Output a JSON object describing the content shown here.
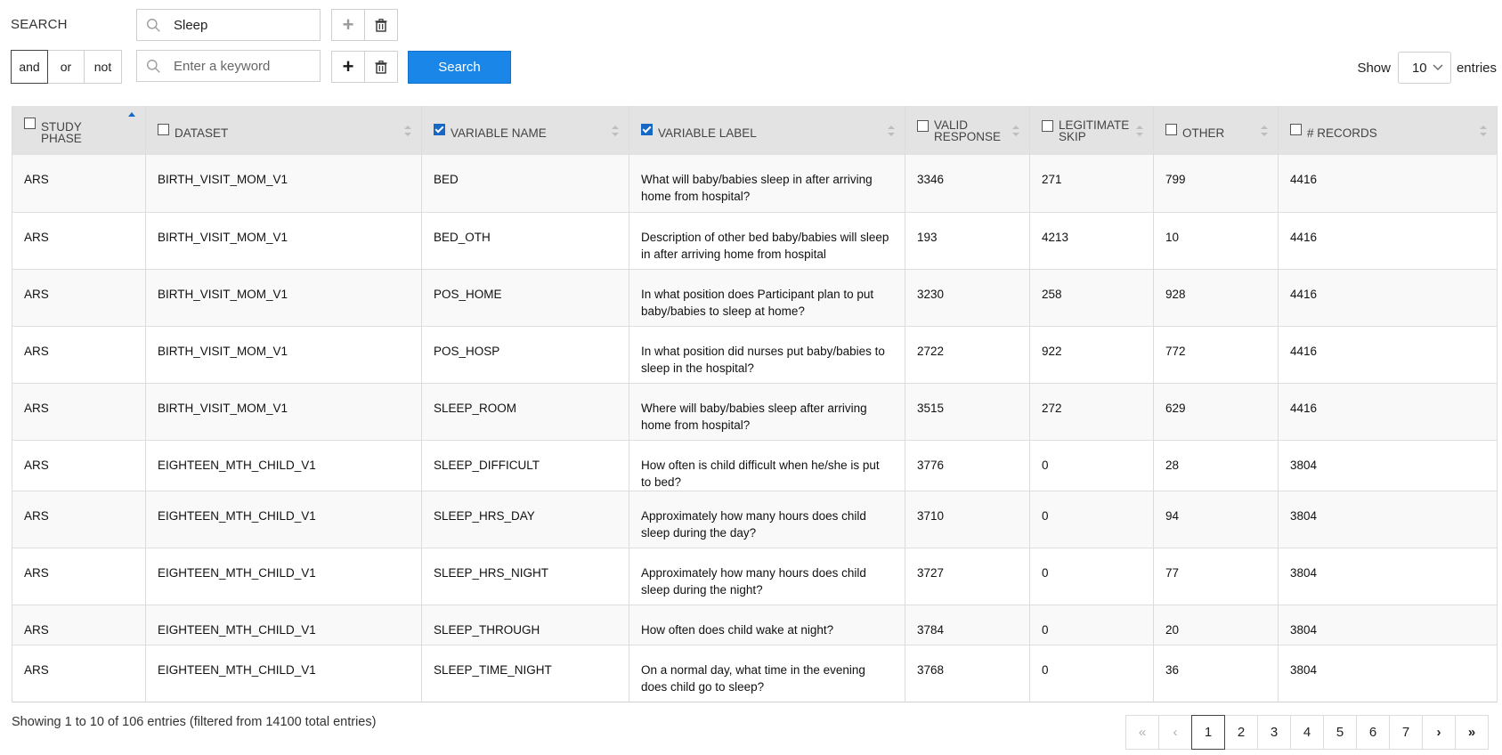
{
  "search": {
    "label": "SEARCH",
    "row1": {
      "value": "Sleep",
      "placeholder": "",
      "add_icon": "plus-icon",
      "delete_icon": "trash-icon"
    },
    "row2": {
      "value": "",
      "placeholder": "Enter a keyword",
      "add_icon": "plus-icon",
      "delete_icon": "trash-icon"
    },
    "logic_options": [
      "and",
      "or",
      "not"
    ],
    "logic_selected": "and",
    "button_label": "Search",
    "button_color": "#1a86e8"
  },
  "show": {
    "prefix": "Show",
    "value": "10",
    "suffix": "entries"
  },
  "table": {
    "columns": [
      {
        "label": "STUDY PHASE",
        "checked": false,
        "sort": "asc"
      },
      {
        "label": "DATASET",
        "checked": false,
        "sort": "none"
      },
      {
        "label": "VARIABLE NAME",
        "checked": true,
        "sort": "none"
      },
      {
        "label": "VARIABLE LABEL",
        "checked": true,
        "sort": "none"
      },
      {
        "label": "VALID RESPONSE",
        "checked": false,
        "sort": "none"
      },
      {
        "label": "LEGITIMATE SKIP",
        "checked": false,
        "sort": "none"
      },
      {
        "label": "OTHER",
        "checked": false,
        "sort": "none"
      },
      {
        "label": "# RECORDS",
        "checked": false,
        "sort": "none"
      }
    ],
    "rows": [
      [
        "ARS",
        "BIRTH_VISIT_MOM_V1",
        "BED",
        "What will baby/babies sleep in after arriving home from hospital?",
        "3346",
        "271",
        "799",
        "4416"
      ],
      [
        "ARS",
        "BIRTH_VISIT_MOM_V1",
        "BED_OTH",
        "Description of other bed baby/babies will sleep in after arriving home from hospital",
        "193",
        "4213",
        "10",
        "4416"
      ],
      [
        "ARS",
        "BIRTH_VISIT_MOM_V1",
        "POS_HOME",
        "In what position does Participant plan to put baby/babies to sleep at home?",
        "3230",
        "258",
        "928",
        "4416"
      ],
      [
        "ARS",
        "BIRTH_VISIT_MOM_V1",
        "POS_HOSP",
        "In what position did nurses put baby/babies to sleep in the hospital?",
        "2722",
        "922",
        "772",
        "4416"
      ],
      [
        "ARS",
        "BIRTH_VISIT_MOM_V1",
        "SLEEP_ROOM",
        "Where will baby/babies sleep after arriving home from hospital?",
        "3515",
        "272",
        "629",
        "4416"
      ],
      [
        "ARS",
        "EIGHTEEN_MTH_CHILD_V1",
        "SLEEP_DIFFICULT",
        "How often is child difficult when he/she is put to bed?",
        "3776",
        "0",
        "28",
        "3804"
      ],
      [
        "ARS",
        "EIGHTEEN_MTH_CHILD_V1",
        "SLEEP_HRS_DAY",
        "Approximately how many hours does child sleep during the day?",
        "3710",
        "0",
        "94",
        "3804"
      ],
      [
        "ARS",
        "EIGHTEEN_MTH_CHILD_V1",
        "SLEEP_HRS_NIGHT",
        "Approximately how many hours does child sleep during the night?",
        "3727",
        "0",
        "77",
        "3804"
      ],
      [
        "ARS",
        "EIGHTEEN_MTH_CHILD_V1",
        "SLEEP_THROUGH",
        "How often does child wake at night?",
        "3784",
        "0",
        "20",
        "3804"
      ],
      [
        "ARS",
        "EIGHTEEN_MTH_CHILD_V1",
        "SLEEP_TIME_NIGHT",
        "On a normal day, what time in the evening does child go to sleep?",
        "3768",
        "0",
        "36",
        "3804"
      ]
    ]
  },
  "footer": {
    "info": "Showing 1 to 10 of 106 entries (filtered from 14100 total entries)",
    "pagination": {
      "first": "«",
      "prev": "‹",
      "pages": [
        "1",
        "2",
        "3",
        "4",
        "5",
        "6",
        "7"
      ],
      "current": "1",
      "next": "›",
      "last": "»"
    }
  }
}
